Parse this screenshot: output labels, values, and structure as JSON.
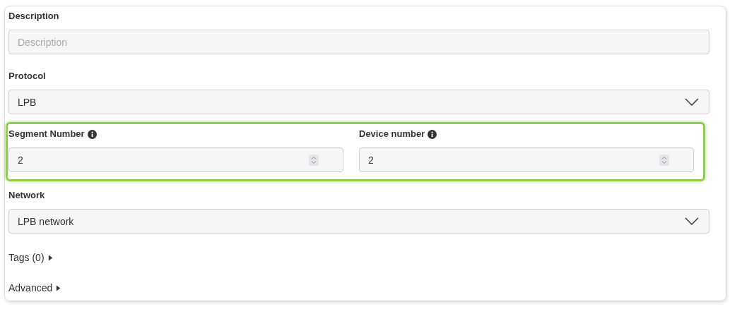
{
  "description": {
    "label": "Description",
    "placeholder": "Description"
  },
  "protocol": {
    "label": "Protocol",
    "value": "LPB"
  },
  "highlighted_group": {
    "highlighted": true,
    "fields": [
      {
        "label": "Segment Number",
        "value": "2"
      },
      {
        "label": "Device number",
        "value": "2"
      }
    ]
  },
  "network": {
    "label": "Network",
    "value": "LPB network"
  },
  "sections": [
    {
      "label": "Tags (0)",
      "expanded": false
    },
    {
      "label": "Advanced",
      "expanded": false
    }
  ]
}
